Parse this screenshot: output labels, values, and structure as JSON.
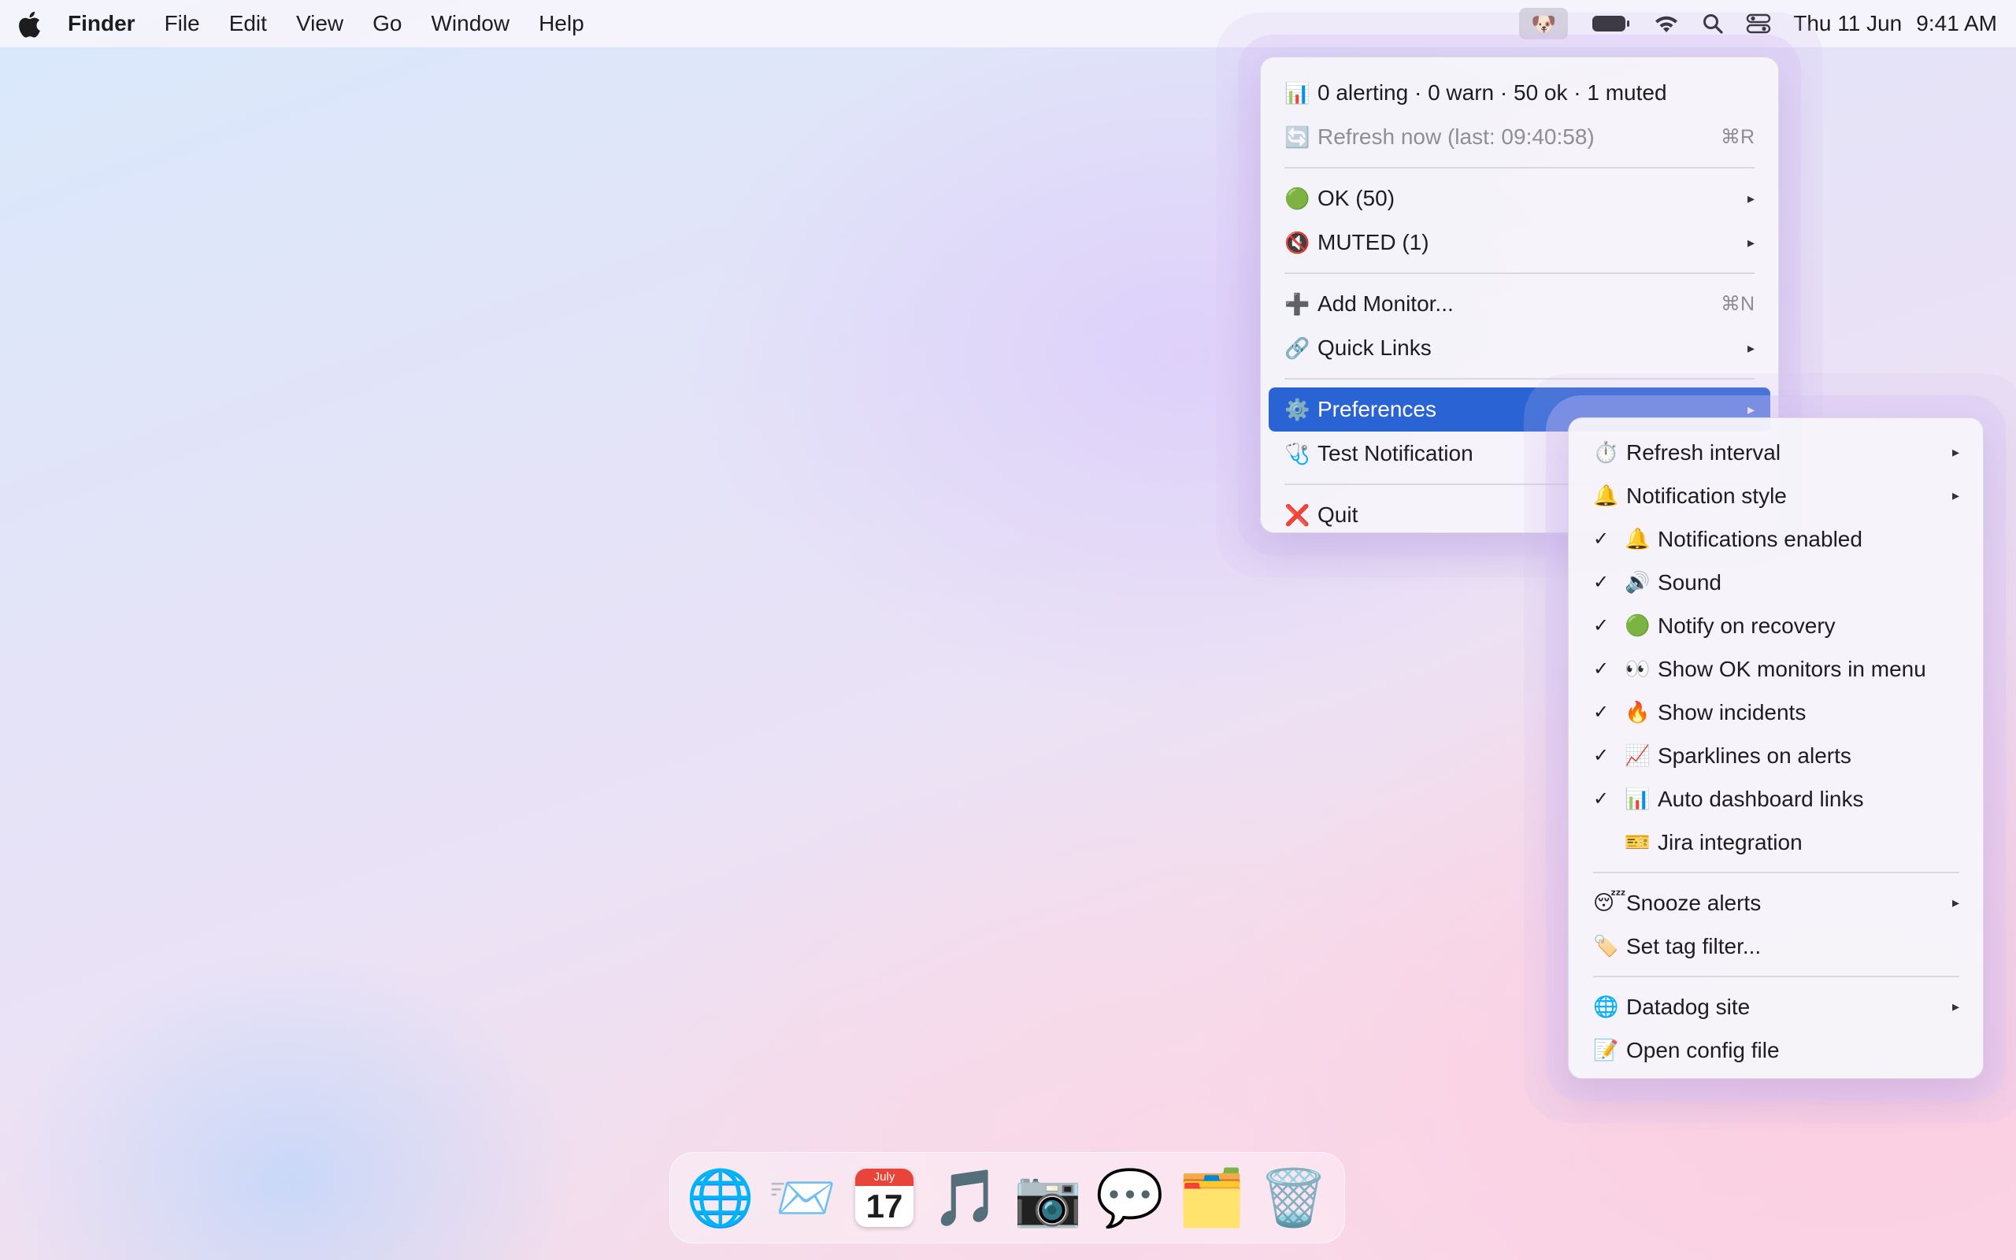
{
  "menubar": {
    "app_name": "Finder",
    "menus": [
      "File",
      "Edit",
      "View",
      "Go",
      "Window",
      "Help"
    ],
    "status_app_icon": "🐶",
    "clock_date": "Thu 11 Jun",
    "clock_time": "9:41 AM",
    "icons": [
      "battery-icon",
      "wifi-icon",
      "search-icon",
      "control-center-icon"
    ]
  },
  "main_menu": {
    "summary": {
      "emoji": "📊",
      "label": "0 alerting · 0 warn · 50 ok · 1 muted"
    },
    "refresh": {
      "emoji": "🔄",
      "label": "Refresh now (last: 09:40:58)",
      "shortcut": "⌘R"
    },
    "ok": {
      "emoji": "🟢",
      "label": "OK (50)"
    },
    "muted": {
      "emoji": "🔇",
      "label": "MUTED (1)"
    },
    "add_monitor": {
      "emoji": "➕",
      "label": "Add Monitor...",
      "shortcut": "⌘N"
    },
    "quick_links": {
      "emoji": "🔗",
      "label": "Quick Links"
    },
    "preferences": {
      "emoji": "⚙️",
      "label": "Preferences"
    },
    "test_notification": {
      "emoji": "🩺",
      "label": "Test Notification"
    },
    "quit": {
      "emoji": "❌",
      "label": "Quit"
    }
  },
  "preferences_menu": {
    "refresh_interval": {
      "emoji": "⏱️",
      "label": "Refresh interval"
    },
    "notification_style": {
      "emoji": "🔔",
      "label": "Notification style"
    },
    "toggles": [
      {
        "checked": true,
        "check": "✓",
        "emoji": "🔔",
        "label": "Notifications enabled"
      },
      {
        "checked": true,
        "check": "✓",
        "emoji": "🔊",
        "label": "Sound"
      },
      {
        "checked": true,
        "check": "✓",
        "emoji": "🟢",
        "label": "Notify on recovery"
      },
      {
        "checked": true,
        "check": "✓",
        "emoji": "👀",
        "label": "Show OK monitors in menu"
      },
      {
        "checked": true,
        "check": "✓",
        "emoji": "🔥",
        "label": "Show incidents"
      },
      {
        "checked": true,
        "check": "✓",
        "emoji": "📈",
        "label": "Sparklines on alerts"
      },
      {
        "checked": true,
        "check": "✓",
        "emoji": "📊",
        "label": "Auto dashboard links"
      },
      {
        "checked": false,
        "check": "",
        "emoji": "🎫",
        "label": "Jira integration"
      }
    ],
    "snooze": {
      "emoji": "😴",
      "label": "Snooze alerts"
    },
    "tag_filter": {
      "emoji": "🏷️",
      "label": "Set tag filter..."
    },
    "datadog_site": {
      "emoji": "🌐",
      "label": "Datadog site"
    },
    "open_config": {
      "emoji": "📝",
      "label": "Open config file"
    }
  },
  "submenu_arrow": "▸",
  "dock": [
    {
      "name": "browser",
      "icon": "🌐"
    },
    {
      "name": "mail",
      "icon": "📨"
    },
    {
      "name": "calendar",
      "month": "July",
      "day": "17"
    },
    {
      "name": "music",
      "icon": "🎵"
    },
    {
      "name": "camera",
      "icon": "📷"
    },
    {
      "name": "messages",
      "icon": "💬"
    },
    {
      "name": "files",
      "icon": "🗂️"
    },
    {
      "name": "trash",
      "icon": "🗑️"
    }
  ]
}
